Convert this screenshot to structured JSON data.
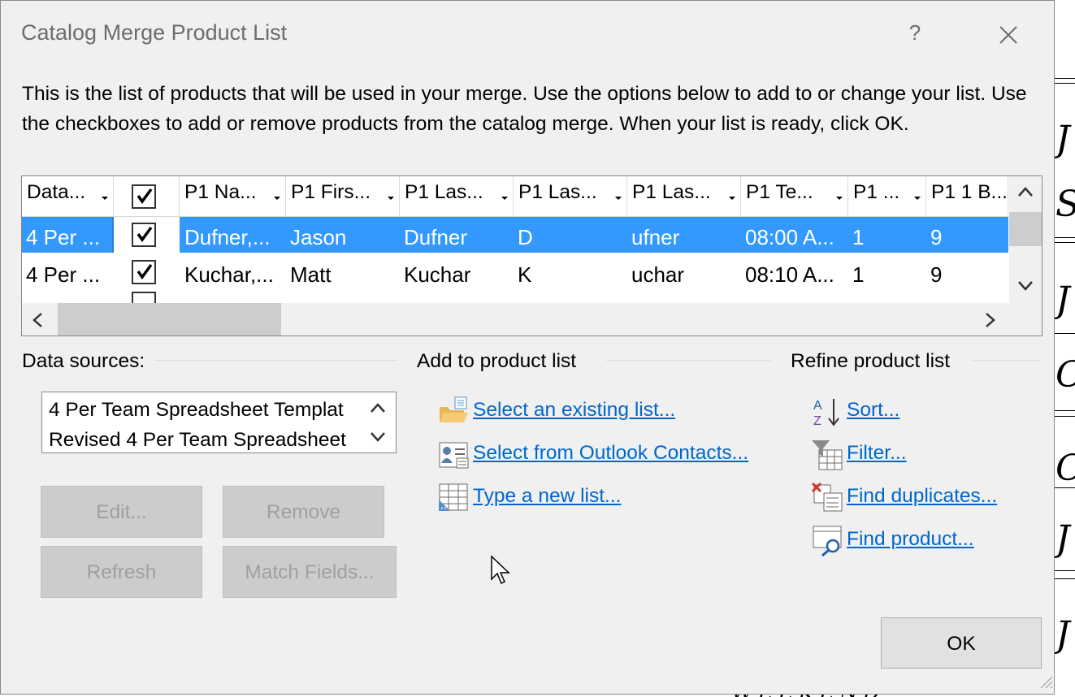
{
  "window": {
    "title": "Catalog Merge Product List",
    "help_label": "?"
  },
  "description": "This is the list of products that will be used in your merge.  Use the options below to add to or change your list.  Use the checkboxes to add or remove products from the catalog merge.  When your list is ready, click OK.",
  "grid": {
    "columns": [
      "Data...",
      "",
      "P1 Na...",
      "P1 Firs...",
      "P1 Las...",
      "P1 Las...",
      "P1 Las...",
      "P1 Te...",
      "P1 ...",
      "P1 1 B..."
    ],
    "rows": [
      {
        "selected": true,
        "checked": true,
        "cells": [
          "4 Per ...",
          "Dufner,...",
          "Jason",
          "Dufner",
          "D",
          "ufner",
          "08:00 A...",
          "1",
          "9"
        ]
      },
      {
        "selected": false,
        "checked": true,
        "cells": [
          "4 Per ...",
          "Kuchar,...",
          "Matt",
          "Kuchar",
          "K",
          "uchar",
          "08:10 A...",
          "1",
          "9"
        ]
      }
    ]
  },
  "data_sources": {
    "label": "Data sources:",
    "items": [
      "4 Per Team Spreadsheet Templat",
      "Revised 4 Per Team Spreadsheet"
    ],
    "buttons": {
      "edit": "Edit...",
      "remove": "Remove",
      "refresh": "Refresh",
      "match_fields": "Match Fields..."
    }
  },
  "add_section": {
    "label": "Add to product list",
    "links": [
      "Select an existing list...",
      "Select from Outlook Contacts...",
      "Type a new list..."
    ]
  },
  "refine_section": {
    "label": "Refine product list",
    "links": [
      "Sort...",
      "Filter...",
      "Find duplicates...",
      "Find product..."
    ]
  },
  "ok_label": "OK"
}
